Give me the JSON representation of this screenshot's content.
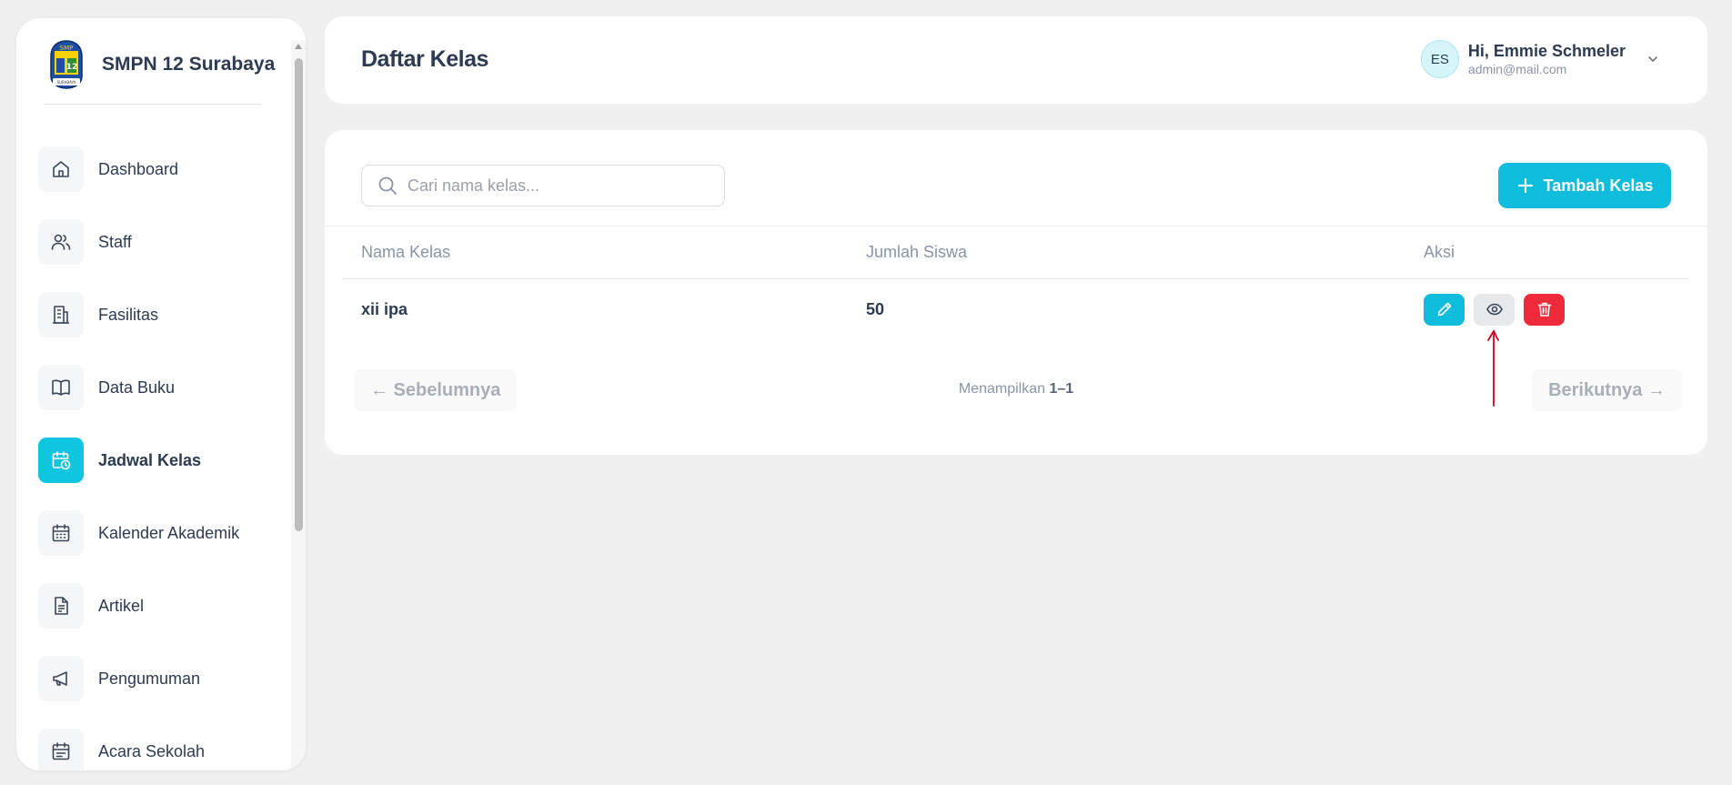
{
  "sidebar": {
    "brand_name": "SMPN 12 Surabaya",
    "logo_text": "SMP",
    "logo_number": "12",
    "logo_caption": "SURABAYA",
    "items": [
      {
        "label": "Dashboard",
        "icon": "home-icon"
      },
      {
        "label": "Staff",
        "icon": "users-icon"
      },
      {
        "label": "Fasilitas",
        "icon": "building-icon"
      },
      {
        "label": "Data Buku",
        "icon": "book-icon"
      },
      {
        "label": "Jadwal Kelas",
        "icon": "calendar-clock-icon",
        "active": true
      },
      {
        "label": "Kalender Akademik",
        "icon": "calendar-icon"
      },
      {
        "label": "Artikel",
        "icon": "document-icon"
      },
      {
        "label": "Pengumuman",
        "icon": "megaphone-icon"
      },
      {
        "label": "Acara Sekolah",
        "icon": "calendar-list-icon"
      }
    ]
  },
  "header": {
    "title": "Daftar Kelas",
    "user": {
      "initials": "ES",
      "greeting": "Hi, Emmie Schmeler",
      "email": "admin@mail.com"
    }
  },
  "main": {
    "search_placeholder": "Cari nama kelas...",
    "add_button_label": "Tambah Kelas",
    "table": {
      "columns": [
        "Nama Kelas",
        "Jumlah Siswa",
        "Aksi"
      ],
      "rows": [
        {
          "nama_kelas": "xii ipa",
          "jumlah_siswa": "50"
        }
      ]
    },
    "pagination": {
      "prev_label": "← Sebelumnya",
      "next_label": "Berikutnya →",
      "info_prefix": "Menampilkan",
      "info_range": "1–1"
    }
  },
  "colors": {
    "accent": "#0ebddc",
    "danger": "#ee2a3b",
    "annotation": "#d0021b"
  }
}
